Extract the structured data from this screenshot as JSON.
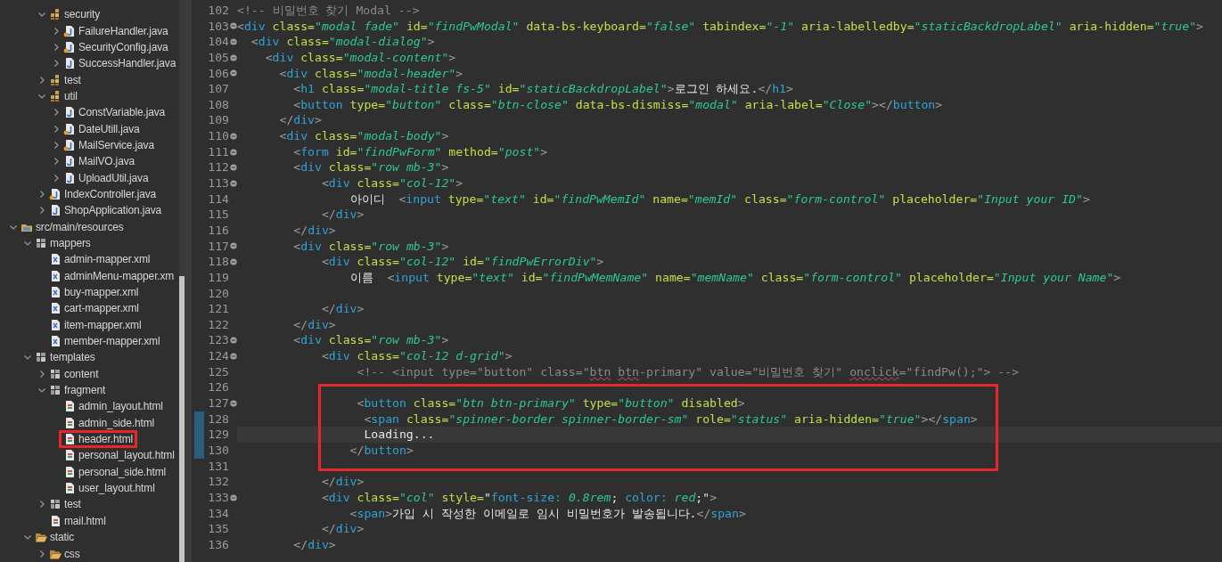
{
  "explorer": {
    "package_items": [
      {
        "label": "security",
        "kind": "package",
        "expanded": true,
        "boxed": false,
        "children": [
          {
            "label": "FailureHandler.java",
            "kind": "java-annotated",
            "expanded": false,
            "boxed": false
          },
          {
            "label": "SecurityConfig.java",
            "kind": "java-annotated",
            "expanded": false,
            "boxed": false
          },
          {
            "label": "SuccessHandler.java",
            "kind": "java",
            "expanded": false,
            "boxed": false
          }
        ]
      },
      {
        "label": "test",
        "kind": "package",
        "expanded": false,
        "boxed": false
      },
      {
        "label": "util",
        "kind": "package",
        "expanded": true,
        "boxed": false,
        "children": [
          {
            "label": "ConstVariable.java",
            "kind": "java",
            "expanded": false,
            "boxed": false
          },
          {
            "label": "DateUtill.java",
            "kind": "java-annotated",
            "expanded": false,
            "boxed": false
          },
          {
            "label": "MailService.java",
            "kind": "java-annotated",
            "expanded": false,
            "boxed": false
          },
          {
            "label": "MailVO.java",
            "kind": "java",
            "expanded": false,
            "boxed": false
          },
          {
            "label": "UploadUtil.java",
            "kind": "java",
            "expanded": false,
            "boxed": false
          }
        ]
      },
      {
        "label": "IndexController.java",
        "kind": "java-annotated",
        "expanded": false,
        "boxed": false
      },
      {
        "label": "ShopApplication.java",
        "kind": "java",
        "expanded": false,
        "boxed": false
      }
    ],
    "resource_tree": [
      {
        "label": "src/main/resources",
        "kind": "source-folder",
        "expanded": true,
        "boxed": false,
        "children": [
          {
            "label": "mappers",
            "kind": "folder",
            "expanded": true,
            "boxed": false,
            "children": [
              {
                "label": "admin-mapper.xml",
                "kind": "xml",
                "boxed": false
              },
              {
                "label": "adminMenu-mapper.xm",
                "kind": "xml",
                "boxed": false
              },
              {
                "label": "buy-mapper.xml",
                "kind": "xml",
                "boxed": false
              },
              {
                "label": "cart-mapper.xml",
                "kind": "xml",
                "boxed": false
              },
              {
                "label": "item-mapper.xml",
                "kind": "xml",
                "boxed": false
              },
              {
                "label": "member-mapper.xml",
                "kind": "xml",
                "boxed": false
              }
            ]
          },
          {
            "label": "templates",
            "kind": "folder",
            "expanded": true,
            "boxed": false,
            "children": [
              {
                "label": "content",
                "kind": "folder",
                "expanded": false,
                "boxed": false
              },
              {
                "label": "fragment",
                "kind": "folder",
                "expanded": true,
                "boxed": false,
                "children": [
                  {
                    "label": "admin_layout.html",
                    "kind": "html",
                    "boxed": false
                  },
                  {
                    "label": "admin_side.html",
                    "kind": "html",
                    "boxed": false
                  },
                  {
                    "label": "header.html",
                    "kind": "html",
                    "boxed": true
                  },
                  {
                    "label": "personal_layout.html",
                    "kind": "html",
                    "boxed": false
                  },
                  {
                    "label": "personal_side.html",
                    "kind": "html",
                    "boxed": false
                  },
                  {
                    "label": "user_layout.html",
                    "kind": "html",
                    "boxed": false
                  }
                ]
              },
              {
                "label": "test",
                "kind": "folder",
                "expanded": false,
                "boxed": false
              },
              {
                "label": "mail.html",
                "kind": "html",
                "boxed": false
              }
            ]
          },
          {
            "label": "static",
            "kind": "open-folder",
            "expanded": true,
            "boxed": false,
            "children": [
              {
                "label": "css",
                "kind": "open-folder",
                "expanded": false,
                "boxed": false
              }
            ]
          }
        ]
      }
    ]
  },
  "editor": {
    "lines": [
      {
        "number": "102",
        "fold": false,
        "changed": false,
        "current": false,
        "boxed": false,
        "tokens": [
          {
            "kind": "comment",
            "text": "<!-- 비밀번호 찾기 Modal -->"
          }
        ]
      },
      {
        "number": "103",
        "fold": true,
        "changed": false,
        "current": false,
        "boxed": false,
        "tokens": [
          {
            "kind": "punct",
            "text": "<"
          },
          {
            "kind": "tag",
            "text": "div"
          },
          {
            "kind": "attr",
            "text": " class="
          },
          {
            "kind": "str",
            "text": "\"modal fade\""
          },
          {
            "kind": "attr",
            "text": " id="
          },
          {
            "kind": "str",
            "text": "\"findPwModal\""
          },
          {
            "kind": "attr",
            "text": " data-bs-keyboard="
          },
          {
            "kind": "str",
            "text": "\"false\""
          },
          {
            "kind": "attr",
            "text": " tabindex="
          },
          {
            "kind": "str",
            "text": "\"-1\""
          },
          {
            "kind": "attr",
            "text": " aria-labelledby="
          },
          {
            "kind": "str",
            "text": "\"staticBackdropLabel\""
          },
          {
            "kind": "attr",
            "text": " aria-hidden="
          },
          {
            "kind": "str",
            "text": "\"true\""
          },
          {
            "kind": "punct",
            "text": ">"
          }
        ]
      },
      {
        "number": "104",
        "fold": true,
        "changed": false,
        "current": false,
        "boxed": false,
        "tokens": [
          {
            "kind": "punct",
            "text": "  <"
          },
          {
            "kind": "tag",
            "text": "div"
          },
          {
            "kind": "attr",
            "text": " class="
          },
          {
            "kind": "str",
            "text": "\"modal-dialog\""
          },
          {
            "kind": "punct",
            "text": ">"
          }
        ]
      },
      {
        "number": "105",
        "fold": true,
        "changed": false,
        "current": false,
        "boxed": false,
        "tokens": [
          {
            "kind": "punct",
            "text": "    <"
          },
          {
            "kind": "tag",
            "text": "div"
          },
          {
            "kind": "attr",
            "text": " class="
          },
          {
            "kind": "str",
            "text": "\"modal-content\""
          },
          {
            "kind": "punct",
            "text": ">"
          }
        ]
      },
      {
        "number": "106",
        "fold": true,
        "changed": false,
        "current": false,
        "boxed": false,
        "tokens": [
          {
            "kind": "punct",
            "text": "      <"
          },
          {
            "kind": "tag",
            "text": "div"
          },
          {
            "kind": "attr",
            "text": " class="
          },
          {
            "kind": "str",
            "text": "\"modal-header\""
          },
          {
            "kind": "punct",
            "text": ">"
          }
        ]
      },
      {
        "number": "107",
        "fold": false,
        "changed": false,
        "current": false,
        "boxed": false,
        "tokens": [
          {
            "kind": "punct",
            "text": "        <"
          },
          {
            "kind": "tag",
            "text": "h1"
          },
          {
            "kind": "attr",
            "text": " class="
          },
          {
            "kind": "str",
            "text": "\"modal-title fs-5\""
          },
          {
            "kind": "attr",
            "text": " id="
          },
          {
            "kind": "str",
            "text": "\"staticBackdropLabel\""
          },
          {
            "kind": "punct",
            "text": ">"
          },
          {
            "kind": "text",
            "text": "로그인 하세요."
          },
          {
            "kind": "punct",
            "text": "</"
          },
          {
            "kind": "tag",
            "text": "h1"
          },
          {
            "kind": "punct",
            "text": ">"
          }
        ]
      },
      {
        "number": "108",
        "fold": false,
        "changed": false,
        "current": false,
        "boxed": false,
        "tokens": [
          {
            "kind": "punct",
            "text": "        <"
          },
          {
            "kind": "tag",
            "text": "button"
          },
          {
            "kind": "attr",
            "text": " type="
          },
          {
            "kind": "str",
            "text": "\"button\""
          },
          {
            "kind": "attr",
            "text": " class="
          },
          {
            "kind": "str",
            "text": "\"btn-close\""
          },
          {
            "kind": "attr",
            "text": " data-bs-dismiss="
          },
          {
            "kind": "str",
            "text": "\"modal\""
          },
          {
            "kind": "attr",
            "text": " aria-label="
          },
          {
            "kind": "str",
            "text": "\"Close\""
          },
          {
            "kind": "punct",
            "text": "></"
          },
          {
            "kind": "tag",
            "text": "button"
          },
          {
            "kind": "punct",
            "text": ">"
          }
        ]
      },
      {
        "number": "109",
        "fold": false,
        "changed": false,
        "current": false,
        "boxed": false,
        "tokens": [
          {
            "kind": "punct",
            "text": "      </"
          },
          {
            "kind": "tag",
            "text": "div"
          },
          {
            "kind": "punct",
            "text": ">"
          }
        ]
      },
      {
        "number": "110",
        "fold": true,
        "changed": false,
        "current": false,
        "boxed": false,
        "tokens": [
          {
            "kind": "punct",
            "text": "      <"
          },
          {
            "kind": "tag",
            "text": "div"
          },
          {
            "kind": "attr",
            "text": " class="
          },
          {
            "kind": "str",
            "text": "\"modal-body\""
          },
          {
            "kind": "punct",
            "text": ">"
          }
        ]
      },
      {
        "number": "111",
        "fold": true,
        "changed": false,
        "current": false,
        "boxed": false,
        "tokens": [
          {
            "kind": "punct",
            "text": "        <"
          },
          {
            "kind": "tag",
            "text": "form"
          },
          {
            "kind": "attr",
            "text": " id="
          },
          {
            "kind": "str",
            "text": "\"findPwForm\""
          },
          {
            "kind": "attr",
            "text": " method="
          },
          {
            "kind": "str",
            "text": "\"post\""
          },
          {
            "kind": "punct",
            "text": ">"
          }
        ]
      },
      {
        "number": "112",
        "fold": true,
        "changed": false,
        "current": false,
        "boxed": false,
        "tokens": [
          {
            "kind": "punct",
            "text": "        <"
          },
          {
            "kind": "tag",
            "text": "div"
          },
          {
            "kind": "attr",
            "text": " class="
          },
          {
            "kind": "str",
            "text": "\"row mb-3\""
          },
          {
            "kind": "punct",
            "text": ">"
          }
        ]
      },
      {
        "number": "113",
        "fold": true,
        "changed": false,
        "current": false,
        "boxed": false,
        "tokens": [
          {
            "kind": "punct",
            "text": "            <"
          },
          {
            "kind": "tag",
            "text": "div"
          },
          {
            "kind": "attr",
            "text": " class="
          },
          {
            "kind": "str",
            "text": "\"col-12\""
          },
          {
            "kind": "punct",
            "text": ">"
          }
        ]
      },
      {
        "number": "114",
        "fold": false,
        "changed": false,
        "current": false,
        "boxed": false,
        "tokens": [
          {
            "kind": "text",
            "text": "                아이디  "
          },
          {
            "kind": "punct",
            "text": "<"
          },
          {
            "kind": "tag",
            "text": "input"
          },
          {
            "kind": "attr",
            "text": " type="
          },
          {
            "kind": "str",
            "text": "\"text\""
          },
          {
            "kind": "attr",
            "text": " id="
          },
          {
            "kind": "str",
            "text": "\"findPwMemId\""
          },
          {
            "kind": "attr",
            "text": " name="
          },
          {
            "kind": "str",
            "text": "\"memId\""
          },
          {
            "kind": "attr",
            "text": " class="
          },
          {
            "kind": "str",
            "text": "\"form-control\""
          },
          {
            "kind": "attr",
            "text": " placeholder="
          },
          {
            "kind": "str",
            "text": "\"Input your ID\""
          },
          {
            "kind": "punct",
            "text": ">"
          }
        ]
      },
      {
        "number": "115",
        "fold": false,
        "changed": false,
        "current": false,
        "boxed": false,
        "tokens": [
          {
            "kind": "punct",
            "text": "            </"
          },
          {
            "kind": "tag",
            "text": "div"
          },
          {
            "kind": "punct",
            "text": ">"
          }
        ]
      },
      {
        "number": "116",
        "fold": false,
        "changed": false,
        "current": false,
        "boxed": false,
        "tokens": [
          {
            "kind": "punct",
            "text": "        </"
          },
          {
            "kind": "tag",
            "text": "div"
          },
          {
            "kind": "punct",
            "text": ">"
          }
        ]
      },
      {
        "number": "117",
        "fold": true,
        "changed": false,
        "current": false,
        "boxed": false,
        "tokens": [
          {
            "kind": "punct",
            "text": "        <"
          },
          {
            "kind": "tag",
            "text": "div"
          },
          {
            "kind": "attr",
            "text": " class="
          },
          {
            "kind": "str",
            "text": "\"row mb-3\""
          },
          {
            "kind": "punct",
            "text": ">"
          }
        ]
      },
      {
        "number": "118",
        "fold": true,
        "changed": false,
        "current": false,
        "boxed": false,
        "tokens": [
          {
            "kind": "punct",
            "text": "            <"
          },
          {
            "kind": "tag",
            "text": "div"
          },
          {
            "kind": "attr",
            "text": " class="
          },
          {
            "kind": "str",
            "text": "\"col-12\""
          },
          {
            "kind": "attr",
            "text": " id="
          },
          {
            "kind": "str",
            "text": "\"findPwErrorDiv\""
          },
          {
            "kind": "punct",
            "text": ">"
          }
        ]
      },
      {
        "number": "119",
        "fold": false,
        "changed": false,
        "current": false,
        "boxed": false,
        "tokens": [
          {
            "kind": "text",
            "text": "                이름  "
          },
          {
            "kind": "punct",
            "text": "<"
          },
          {
            "kind": "tag",
            "text": "input"
          },
          {
            "kind": "attr",
            "text": " type="
          },
          {
            "kind": "str",
            "text": "\"text\""
          },
          {
            "kind": "attr",
            "text": " id="
          },
          {
            "kind": "str",
            "text": "\"findPwMemName\""
          },
          {
            "kind": "attr",
            "text": " name="
          },
          {
            "kind": "str",
            "text": "\"memName\""
          },
          {
            "kind": "attr",
            "text": " class="
          },
          {
            "kind": "str",
            "text": "\"form-control\""
          },
          {
            "kind": "attr",
            "text": " placeholder="
          },
          {
            "kind": "str",
            "text": "\"Input your Name\""
          },
          {
            "kind": "punct",
            "text": ">"
          }
        ]
      },
      {
        "number": "120",
        "fold": false,
        "changed": false,
        "current": false,
        "boxed": false
      },
      {
        "number": "121",
        "fold": false,
        "changed": false,
        "current": false,
        "boxed": false,
        "tokens": [
          {
            "kind": "punct",
            "text": "            </"
          },
          {
            "kind": "tag",
            "text": "div"
          },
          {
            "kind": "punct",
            "text": ">"
          }
        ]
      },
      {
        "number": "122",
        "fold": false,
        "changed": false,
        "current": false,
        "boxed": false,
        "tokens": [
          {
            "kind": "punct",
            "text": "        </"
          },
          {
            "kind": "tag",
            "text": "div"
          },
          {
            "kind": "punct",
            "text": ">"
          }
        ]
      },
      {
        "number": "123",
        "fold": true,
        "changed": false,
        "current": false,
        "boxed": false,
        "tokens": [
          {
            "kind": "punct",
            "text": "        <"
          },
          {
            "kind": "tag",
            "text": "div"
          },
          {
            "kind": "attr",
            "text": " class="
          },
          {
            "kind": "str",
            "text": "\"row mb-3\""
          },
          {
            "kind": "punct",
            "text": ">"
          }
        ]
      },
      {
        "number": "124",
        "fold": true,
        "changed": false,
        "current": false,
        "boxed": false,
        "tokens": [
          {
            "kind": "punct",
            "text": "            <"
          },
          {
            "kind": "tag",
            "text": "div"
          },
          {
            "kind": "attr",
            "text": " class="
          },
          {
            "kind": "str",
            "text": "\"col-12 d-grid\""
          },
          {
            "kind": "punct",
            "text": ">"
          }
        ]
      },
      {
        "number": "125",
        "fold": false,
        "changed": false,
        "current": false,
        "boxed": false,
        "tokens": [
          {
            "kind": "comment",
            "text": "                 <!-- <input type=\"button\" class=\""
          },
          {
            "kind": "typo",
            "text": "btn"
          },
          {
            "kind": "typo",
            "text": " btn"
          },
          {
            "kind": "comment",
            "text": "-primary\" value=\"비밀번호 찾기\" "
          },
          {
            "kind": "typo",
            "text": "onclick"
          },
          {
            "kind": "comment",
            "text": "=\"findPw();\"> -->"
          }
        ]
      },
      {
        "number": "126",
        "fold": false,
        "changed": false,
        "current": false,
        "boxed": true
      },
      {
        "number": "127",
        "fold": true,
        "changed": false,
        "current": false,
        "boxed": true,
        "tokens": [
          {
            "kind": "punct",
            "text": "                 <"
          },
          {
            "kind": "tag",
            "text": "button"
          },
          {
            "kind": "attr",
            "text": " class="
          },
          {
            "kind": "str",
            "text": "\"btn btn-primary\""
          },
          {
            "kind": "attr",
            "text": " type="
          },
          {
            "kind": "str",
            "text": "\"button\""
          },
          {
            "kind": "attr",
            "text": " disabled"
          },
          {
            "kind": "punct",
            "text": ">"
          }
        ]
      },
      {
        "number": "128",
        "fold": false,
        "changed": true,
        "current": false,
        "boxed": true,
        "tokens": [
          {
            "kind": "punct",
            "text": "                  <"
          },
          {
            "kind": "tag",
            "text": "span"
          },
          {
            "kind": "attr",
            "text": " class="
          },
          {
            "kind": "str",
            "text": "\"spinner-border spinner-border-sm\""
          },
          {
            "kind": "attr",
            "text": " role="
          },
          {
            "kind": "str",
            "text": "\"status\""
          },
          {
            "kind": "attr",
            "text": " aria-hidden="
          },
          {
            "kind": "str",
            "text": "\"true\""
          },
          {
            "kind": "punct",
            "text": "></"
          },
          {
            "kind": "tag",
            "text": "span"
          },
          {
            "kind": "punct",
            "text": ">"
          }
        ]
      },
      {
        "number": "129",
        "fold": false,
        "changed": true,
        "current": true,
        "boxed": true,
        "tokens": [
          {
            "kind": "text",
            "text": "                  Loading..."
          }
        ]
      },
      {
        "number": "130",
        "fold": false,
        "changed": true,
        "current": false,
        "boxed": true,
        "tokens": [
          {
            "kind": "punct",
            "text": "                </"
          },
          {
            "kind": "tag",
            "text": "button"
          },
          {
            "kind": "punct",
            "text": ">"
          }
        ]
      },
      {
        "number": "131",
        "fold": false,
        "changed": false,
        "current": false,
        "boxed": true
      },
      {
        "number": "132",
        "fold": false,
        "changed": false,
        "current": false,
        "boxed": false,
        "tokens": [
          {
            "kind": "punct",
            "text": "            </"
          },
          {
            "kind": "tag",
            "text": "div"
          },
          {
            "kind": "punct",
            "text": ">"
          }
        ]
      },
      {
        "number": "133",
        "fold": true,
        "changed": false,
        "current": false,
        "boxed": false,
        "tokens": [
          {
            "kind": "punct",
            "text": "            <"
          },
          {
            "kind": "tag",
            "text": "div"
          },
          {
            "kind": "attr",
            "text": " class="
          },
          {
            "kind": "str",
            "text": "\"col\""
          },
          {
            "kind": "attr",
            "text": " style="
          },
          {
            "kind": "text",
            "text": "\""
          },
          {
            "kind": "cssprop",
            "text": "font-size:"
          },
          {
            "kind": "cssval",
            "text": " 0.8rem"
          },
          {
            "kind": "text",
            "text": ";"
          },
          {
            "kind": "cssprop",
            "text": " color:"
          },
          {
            "kind": "cssval",
            "text": " red"
          },
          {
            "kind": "text",
            "text": ";\""
          },
          {
            "kind": "punct",
            "text": ">"
          }
        ]
      },
      {
        "number": "134",
        "fold": false,
        "changed": false,
        "current": false,
        "boxed": false,
        "tokens": [
          {
            "kind": "punct",
            "text": "                <"
          },
          {
            "kind": "tag",
            "text": "span"
          },
          {
            "kind": "punct",
            "text": ">"
          },
          {
            "kind": "text",
            "text": "가입 시 작성한 이메일로 임시 비밀번호가 발송됩니다."
          },
          {
            "kind": "punct",
            "text": "</"
          },
          {
            "kind": "tag",
            "text": "span"
          },
          {
            "kind": "punct",
            "text": ">"
          }
        ]
      },
      {
        "number": "135",
        "fold": false,
        "changed": false,
        "current": false,
        "boxed": false,
        "tokens": [
          {
            "kind": "punct",
            "text": "            </"
          },
          {
            "kind": "tag",
            "text": "div"
          },
          {
            "kind": "punct",
            "text": ">"
          }
        ]
      },
      {
        "number": "136",
        "fold": false,
        "changed": false,
        "current": false,
        "boxed": false,
        "tokens": [
          {
            "kind": "punct",
            "text": "        </"
          },
          {
            "kind": "tag",
            "text": "div"
          },
          {
            "kind": "punct",
            "text": ">"
          }
        ]
      }
    ]
  }
}
